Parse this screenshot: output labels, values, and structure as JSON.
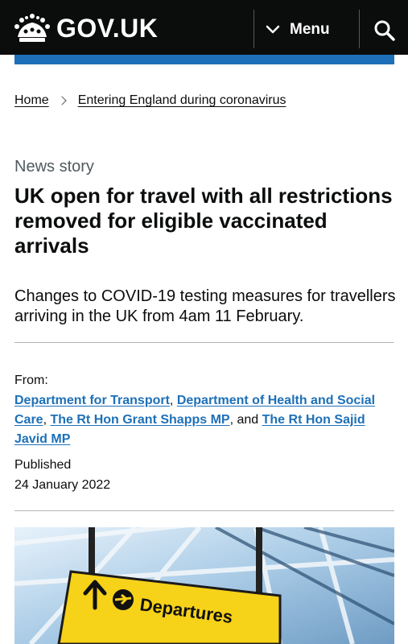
{
  "header": {
    "logo_text": "GOV.UK",
    "menu_label": "Menu",
    "colors": {
      "background": "#0b0c0c",
      "brand_bar": "#1d70b8"
    },
    "icons": {
      "logo": "crown-icon",
      "menu": "chevron-down-icon",
      "search": "search-icon"
    }
  },
  "breadcrumb": {
    "items": [
      "Home",
      "Entering England during coronavirus"
    ],
    "separator_icon": "chevron-right-icon"
  },
  "article": {
    "caption": "News story",
    "title": "UK open for travel with all restrictions removed for eligible vaccinated arrivals",
    "lead": "Changes to COVID-19 testing measures for travellers arriving in the UK from 4am 11 February."
  },
  "metadata": {
    "from_label": "From:",
    "organisations": [
      "Department for Transport",
      "Department of Health and Social Care",
      "The Rt Hon Grant Shapps MP",
      "The Rt Hon Sajid Javid MP"
    ],
    "separator": ", ",
    "conjunction": ", and ",
    "published_label": "Published",
    "published_date": "24 January 2022",
    "link_color": "#1d70b8"
  },
  "image": {
    "sign_text": "Departures",
    "icons": [
      "up-arrow-icon",
      "airplane-icon"
    ],
    "sign_color": "#f6d219"
  }
}
